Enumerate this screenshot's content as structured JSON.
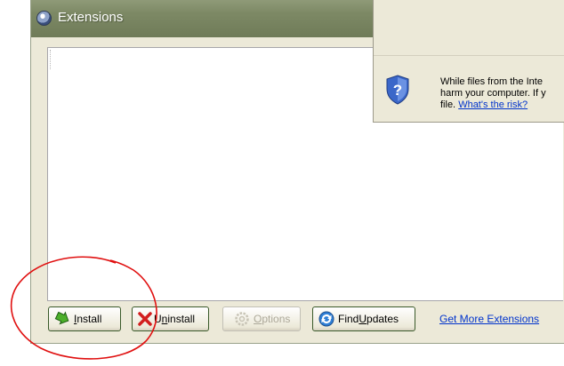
{
  "window": {
    "title": "Extensions"
  },
  "buttons": {
    "install": {
      "mnemonic": "I",
      "rest": "nstall"
    },
    "uninstall": {
      "pre": "U",
      "mnemonic": "n",
      "rest": "install"
    },
    "options": {
      "mnemonic": "O",
      "rest": "ptions"
    },
    "find_updates": {
      "pre": "Find ",
      "mnemonic": "U",
      "rest": "pdates"
    }
  },
  "link": {
    "get_more": "Get More Extensions"
  },
  "security": {
    "line1": "While files from the Inte",
    "line2": "harm your computer. If y",
    "line3_prefix": "file. ",
    "risk_link": "What's the risk?"
  },
  "colors": {
    "annotation": "#e01010",
    "link": "#0033cc",
    "title_bar": "#7d8965"
  },
  "icons": [
    "extensions-app-icon",
    "install-arrow-icon",
    "uninstall-x-icon",
    "options-gear-icon",
    "find-updates-icon",
    "security-shield-icon"
  ]
}
